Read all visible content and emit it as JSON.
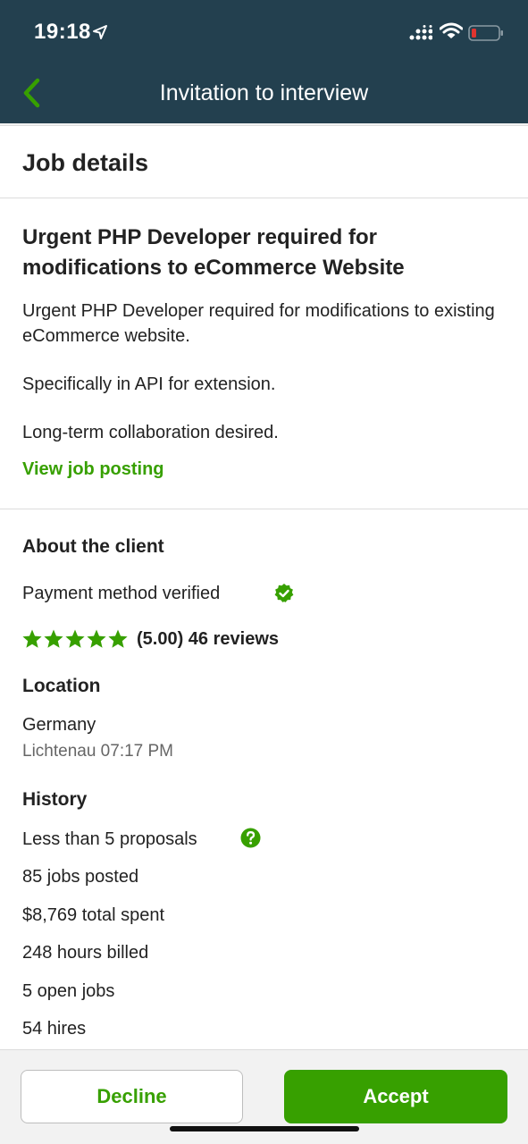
{
  "status_bar": {
    "time": "19:18"
  },
  "nav": {
    "title": "Invitation to interview"
  },
  "job_details": {
    "header": "Job details",
    "title": "Urgent PHP Developer required for modifications to eCommerce Website",
    "paragraphs": [
      "Urgent PHP Developer required for modifications to existing eCommerce website.",
      "Specifically in API for extension.",
      "Long-term collaboration desired."
    ],
    "view_link": "View job posting"
  },
  "client": {
    "header": "About the client",
    "payment": "Payment method verified",
    "rating": 5,
    "rating_text": "(5.00) 46 reviews",
    "location_label": "Location",
    "country": "Germany",
    "city_time": "Lichtenau 07:17 PM",
    "history_label": "History",
    "history": [
      "Less than 5 proposals",
      "85 jobs posted",
      "$8,769 total spent",
      "248 hours billed",
      "5 open jobs",
      "54 hires"
    ]
  },
  "actions": {
    "decline": "Decline",
    "accept": "Accept"
  },
  "colors": {
    "brand_green": "#37a000",
    "header_bg": "#23404f",
    "battery_low": "#e0342f"
  }
}
